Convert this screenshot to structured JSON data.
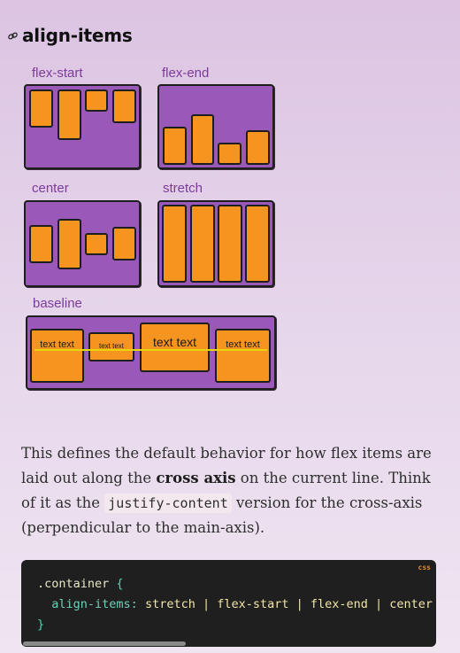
{
  "heading": {
    "title": "align-items",
    "link_icon": "link-icon"
  },
  "diagrams": {
    "flex_start": {
      "label": "flex-start"
    },
    "flex_end": {
      "label": "flex-end"
    },
    "center": {
      "label": "center"
    },
    "stretch": {
      "label": "stretch"
    },
    "baseline": {
      "label": "baseline",
      "items": [
        "text text",
        "text text",
        "text text",
        "text text"
      ]
    }
  },
  "description": {
    "part1": "This defines the default behavior for how flex items are laid out along the ",
    "bold": "cross axis",
    "part2": " on the current line. Think of it as the ",
    "code": "justify-content",
    "part3": " version for the cross-axis (perpendicular to the main-axis)."
  },
  "code_block": {
    "language": "css",
    "selector": ".container",
    "open_brace": "{",
    "property": "align-items:",
    "value": " stretch | flex-start | flex-end | center | baseline | first baseline | last baseline;",
    "close_brace": "}"
  },
  "colors": {
    "container": "#9a59b8",
    "item": "#f5941f",
    "label": "#7c3a9a",
    "baseline_line": "#e8d40a",
    "code_bg": "#1f1f1f"
  }
}
